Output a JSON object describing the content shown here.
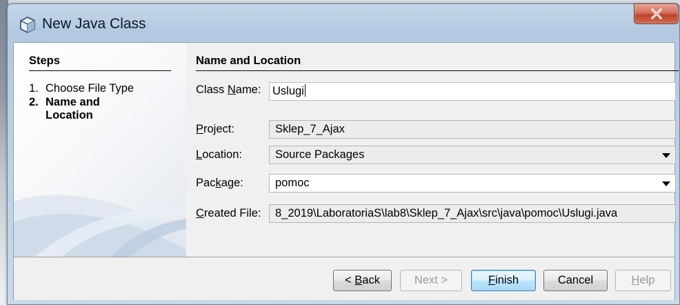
{
  "window": {
    "title": "New Java Class",
    "close_glyph": "X",
    "app_icon": "java-cube-icon"
  },
  "steps": {
    "title": "Steps",
    "items": [
      {
        "number": "1.",
        "label_line1": "Choose File Type",
        "label_line2": ""
      },
      {
        "number": "2.",
        "label_line1": "Name and",
        "label_line2": "Location"
      }
    ]
  },
  "main": {
    "section_title": "Name and Location",
    "class_name": {
      "label_pre": "Class ",
      "label_mnemonic": "N",
      "label_post": "ame:",
      "value": "Uslugi"
    },
    "project": {
      "label_pre": "",
      "label_mnemonic": "P",
      "label_post": "roject:",
      "value": "Sklep_7_Ajax"
    },
    "location": {
      "label_pre": "",
      "label_mnemonic": "L",
      "label_post": "ocation:",
      "value": "Source Packages"
    },
    "package": {
      "label_pre": "Pac",
      "label_mnemonic": "k",
      "label_post": "age:",
      "value": "pomoc"
    },
    "created_file": {
      "label_pre": "",
      "label_mnemonic": "C",
      "label_post": "reated File:",
      "value": "8_2019\\LaboratoriaS\\lab8\\Sklep_7_Ajax\\src\\java\\pomoc\\Uslugi.java"
    }
  },
  "buttons": {
    "back": {
      "pre": "< ",
      "mnemonic": "B",
      "post": "ack"
    },
    "next": {
      "pre": "Next >",
      "mnemonic": "",
      "post": ""
    },
    "finish": {
      "pre": "",
      "mnemonic": "F",
      "post": "inish"
    },
    "cancel": {
      "pre": "Cancel",
      "mnemonic": "",
      "post": ""
    },
    "help": {
      "pre": "",
      "mnemonic": "H",
      "post": "elp"
    }
  },
  "colors": {
    "default_button_border": "#3c7fb1",
    "close_button": "#c04429"
  }
}
